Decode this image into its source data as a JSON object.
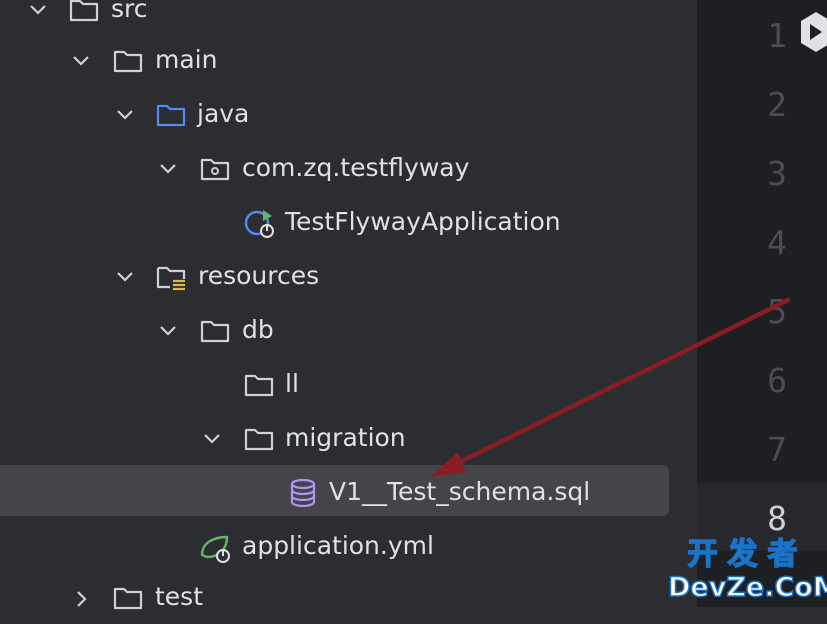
{
  "project_tree": {
    "src": {
      "label": "src"
    },
    "main": {
      "label": "main"
    },
    "java": {
      "label": "java"
    },
    "package": {
      "label": "com.zq.testflyway"
    },
    "app_class": {
      "label": "TestFlywayApplication"
    },
    "resources": {
      "label": "resources"
    },
    "db": {
      "label": "db"
    },
    "ll": {
      "label": "ll"
    },
    "migration": {
      "label": "migration"
    },
    "sql_file": {
      "label": "V1__Test_schema.sql"
    },
    "application_yml": {
      "label": "application.yml"
    },
    "test": {
      "label": "test"
    }
  },
  "editor": {
    "line_numbers": [
      "1",
      "2",
      "3",
      "4",
      "5",
      "6",
      "7",
      "8"
    ],
    "current_line": "8"
  },
  "watermark": {
    "top": "开发者",
    "bottom": "DevZe.CoM"
  },
  "colors": {
    "panel_bg": "#2b2d30",
    "editor_bg": "#1e1f22",
    "selection_bg": "#43454a",
    "folder_icon": "#ced0d6",
    "java_folder_icon": "#548af7",
    "sql_icon": "#b392f0",
    "spring_icon": "#5fb865",
    "resources_badge": "#e0b64a",
    "annotation_arrow": "#8b1c24"
  }
}
